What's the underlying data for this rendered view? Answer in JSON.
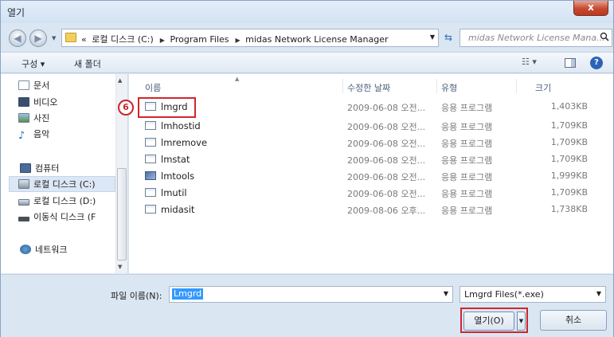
{
  "window": {
    "title": "열기",
    "close_label": "x"
  },
  "address_bar": {
    "prefix": "«",
    "crumbs": [
      "로컬 디스크 (C:)",
      "Program Files",
      "midas Network License Manager"
    ],
    "search_placeholder": "midas Network License Mana..."
  },
  "toolbar": {
    "organize": "구성 ▾",
    "new_folder": "새 폴더",
    "views": "☷ ▾",
    "help": "?"
  },
  "nav": {
    "items": [
      {
        "label": "문서",
        "icon": "document-icon"
      },
      {
        "label": "비디오",
        "icon": "video-icon"
      },
      {
        "label": "사진",
        "icon": "picture-icon"
      },
      {
        "label": "음악",
        "icon": "music-icon"
      },
      {
        "label": "컴퓨터",
        "icon": "computer-icon"
      },
      {
        "label": "로컬 디스크 (C:)",
        "icon": "local-disk-icon",
        "selected": true
      },
      {
        "label": "로컬 디스크 (D:)",
        "icon": "local-disk-icon"
      },
      {
        "label": "이동식 디스크 (F",
        "icon": "removable-disk-icon"
      },
      {
        "label": "네트워크",
        "icon": "network-icon"
      }
    ]
  },
  "columns": {
    "name": "이름",
    "date": "수정한 날짜",
    "type": "유형",
    "size": "크기"
  },
  "files": [
    {
      "name": "lmgrd",
      "date": "2009-06-08 오전...",
      "type": "응용 프로그램",
      "size": "1,403KB"
    },
    {
      "name": "lmhostid",
      "date": "2009-06-08 오전...",
      "type": "응용 프로그램",
      "size": "1,709KB"
    },
    {
      "name": "lmremove",
      "date": "2009-06-08 오전...",
      "type": "응용 프로그램",
      "size": "1,709KB"
    },
    {
      "name": "lmstat",
      "date": "2009-06-08 오전...",
      "type": "응용 프로그램",
      "size": "1,709KB"
    },
    {
      "name": "lmtools",
      "date": "2009-06-08 오전...",
      "type": "응용 프로그램",
      "size": "1,999KB"
    },
    {
      "name": "lmutil",
      "date": "2009-06-08 오전...",
      "type": "응용 프로그램",
      "size": "1,709KB"
    },
    {
      "name": "midasit",
      "date": "2009-08-06 오후...",
      "type": "응용 프로그램",
      "size": "1,738KB"
    }
  ],
  "annotation": {
    "step_number": "6"
  },
  "bottom": {
    "filename_label": "파일 이름(N):",
    "filename_value": "Lmgrd",
    "filetype_value": "Lmgrd Files(*.exe)",
    "open_label": "열기(O)",
    "cancel_label": "취소"
  },
  "colors": {
    "highlight": "#d0262c",
    "selection": "#3399ff"
  }
}
